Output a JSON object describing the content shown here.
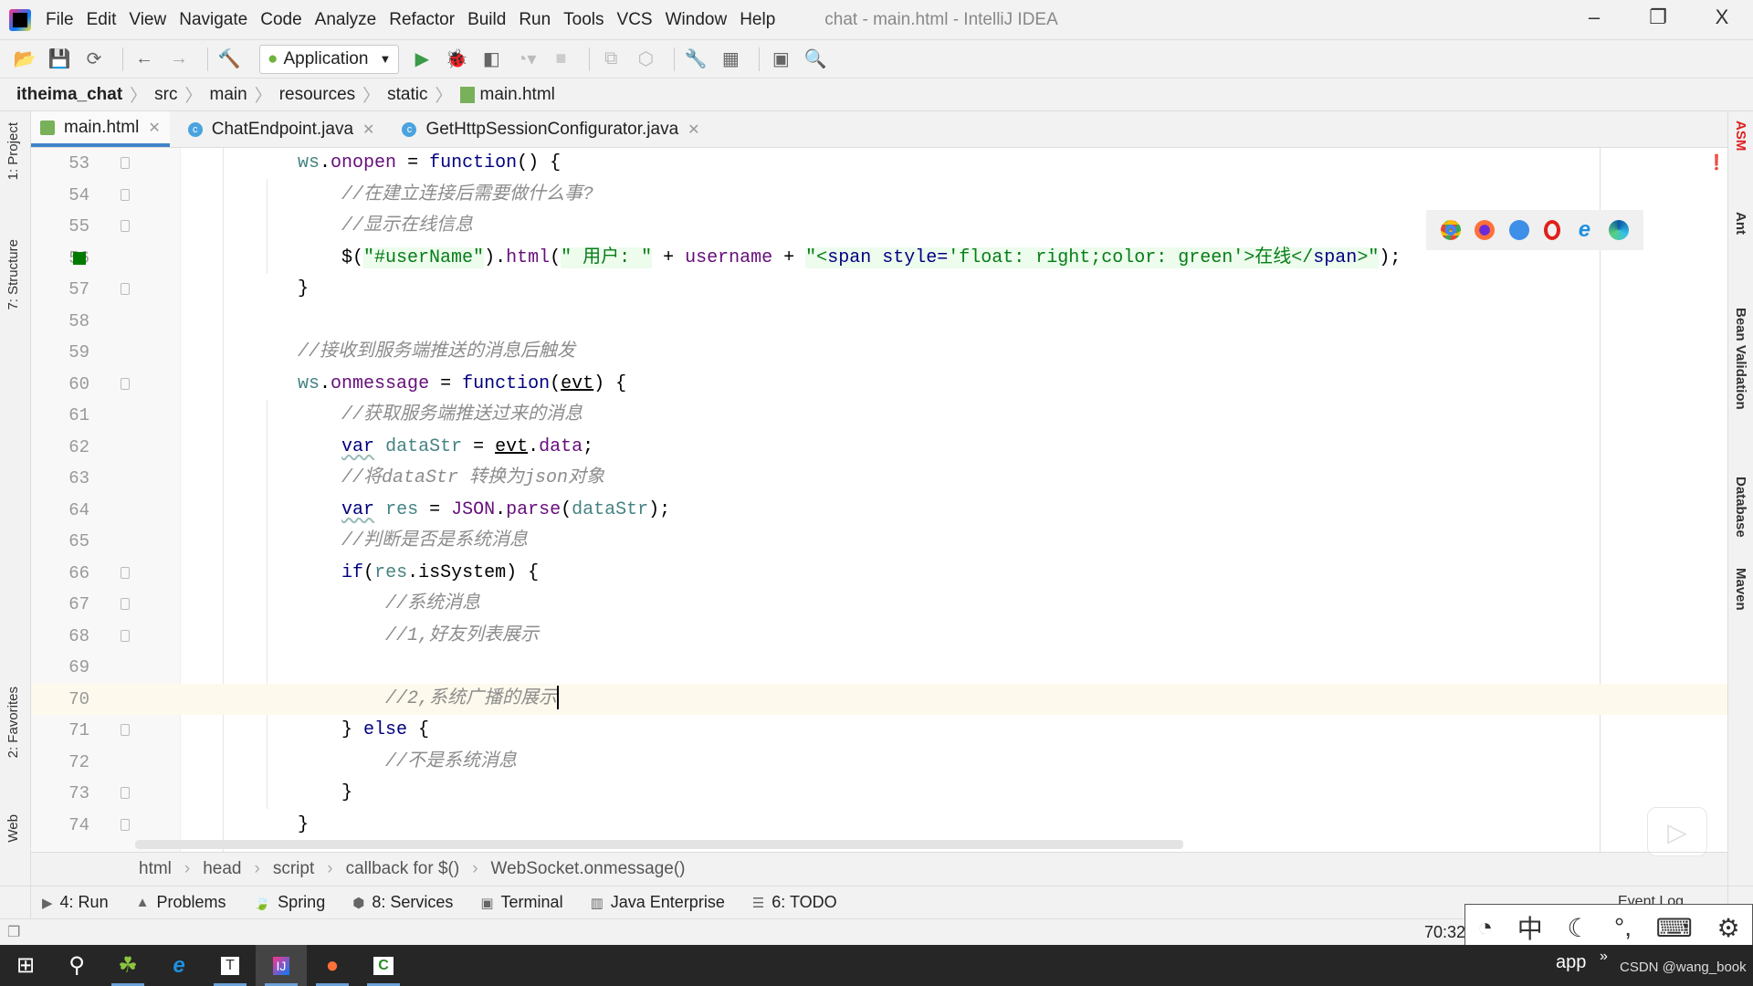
{
  "window": {
    "title": "chat - main.html - IntelliJ IDEA",
    "minimize": "–",
    "restore": "❐",
    "close": "X"
  },
  "menu": [
    "File",
    "Edit",
    "View",
    "Navigate",
    "Code",
    "Analyze",
    "Refactor",
    "Build",
    "Run",
    "Tools",
    "VCS",
    "Window",
    "Help"
  ],
  "toolbar": {
    "run_config": "Application"
  },
  "breadcrumb": [
    "itheima_chat",
    "src",
    "main",
    "resources",
    "static",
    "main.html"
  ],
  "tabs": [
    {
      "label": "main.html",
      "active": true,
      "icon": "html-file-icon"
    },
    {
      "label": "ChatEndpoint.java",
      "icon": "java-class-icon"
    },
    {
      "label": "GetHttpSessionConfigurator.java",
      "icon": "java-class-icon"
    }
  ],
  "left_tools": [
    "1: Project",
    "7: Structure",
    "2: Favorites",
    "Web"
  ],
  "right_tools": [
    "ASM",
    "Ant",
    "Bean Validation",
    "Database",
    "Maven"
  ],
  "code": {
    "current_line": 70,
    "lines": [
      {
        "n": 53,
        "fold": true,
        "tokens": [
          [
            "t",
            "        "
          ],
          [
            "v",
            "ws"
          ],
          [
            "t",
            "."
          ],
          [
            "p",
            "onopen"
          ],
          [
            "t",
            " = "
          ],
          [
            "k",
            "function"
          ],
          [
            "t",
            "() {"
          ]
        ]
      },
      {
        "n": 54,
        "fold": true,
        "tokens": [
          [
            "t",
            "            "
          ],
          [
            "c",
            "//在建立连接后需要做什么事?"
          ]
        ]
      },
      {
        "n": 55,
        "fold": true,
        "tokens": [
          [
            "t",
            "            "
          ],
          [
            "c",
            "//显示在线信息"
          ]
        ]
      },
      {
        "n": 56,
        "mark": true,
        "tokens": [
          [
            "t",
            "            $("
          ],
          [
            "s",
            "\"#userName\""
          ],
          [
            "t",
            ")."
          ],
          [
            "p",
            "html"
          ],
          [
            "t",
            "("
          ],
          [
            "s",
            "\" 用户: \""
          ],
          [
            "t",
            " + "
          ],
          [
            "p",
            "username"
          ],
          [
            "t",
            " + "
          ],
          [
            "s",
            "\"<"
          ],
          [
            "g",
            "span style="
          ],
          [
            "s",
            "'float: right;color: green'"
          ],
          [
            "s",
            ">在线</"
          ],
          [
            "g",
            "span"
          ],
          [
            "s",
            ">\""
          ],
          [
            "t",
            ");"
          ]
        ]
      },
      {
        "n": 57,
        "fold": true,
        "tokens": [
          [
            "t",
            "        }"
          ]
        ]
      },
      {
        "n": 58,
        "tokens": []
      },
      {
        "n": 59,
        "tokens": [
          [
            "t",
            "        "
          ],
          [
            "c",
            "//接收到服务端推送的消息后触发"
          ]
        ]
      },
      {
        "n": 60,
        "fold": true,
        "tokens": [
          [
            "t",
            "        "
          ],
          [
            "v",
            "ws"
          ],
          [
            "t",
            "."
          ],
          [
            "p",
            "onmessage"
          ],
          [
            "t",
            " = "
          ],
          [
            "k",
            "function"
          ],
          [
            "t",
            "("
          ],
          [
            "u",
            "evt"
          ],
          [
            "t",
            ") {"
          ]
        ]
      },
      {
        "n": 61,
        "tokens": [
          [
            "t",
            "            "
          ],
          [
            "c",
            "//获取服务端推送过来的消息"
          ]
        ]
      },
      {
        "n": 62,
        "tokens": [
          [
            "t",
            "            "
          ],
          [
            "w",
            "var"
          ],
          [
            "t",
            " "
          ],
          [
            "v",
            "dataStr"
          ],
          [
            "t",
            " = "
          ],
          [
            "u",
            "evt"
          ],
          [
            "t",
            "."
          ],
          [
            "p",
            "data"
          ],
          [
            "t",
            ";"
          ]
        ]
      },
      {
        "n": 63,
        "tokens": [
          [
            "t",
            "            "
          ],
          [
            "c",
            "//将dataStr 转换为json对象"
          ]
        ]
      },
      {
        "n": 64,
        "tokens": [
          [
            "t",
            "            "
          ],
          [
            "w",
            "var"
          ],
          [
            "t",
            " "
          ],
          [
            "v",
            "res"
          ],
          [
            "t",
            " = "
          ],
          [
            "p",
            "JSON"
          ],
          [
            "t",
            "."
          ],
          [
            "p",
            "parse"
          ],
          [
            "t",
            "("
          ],
          [
            "v",
            "dataStr"
          ],
          [
            "t",
            ");"
          ]
        ]
      },
      {
        "n": 65,
        "tokens": [
          [
            "t",
            "            "
          ],
          [
            "c",
            "//判断是否是系统消息"
          ]
        ]
      },
      {
        "n": 66,
        "fold": true,
        "tokens": [
          [
            "t",
            "            "
          ],
          [
            "k",
            "if"
          ],
          [
            "t",
            "("
          ],
          [
            "v",
            "res"
          ],
          [
            "t",
            "."
          ],
          [
            "t",
            "isSystem"
          ],
          [
            "t",
            ") {"
          ]
        ]
      },
      {
        "n": 67,
        "fold": true,
        "tokens": [
          [
            "t",
            "                "
          ],
          [
            "c",
            "//系统消息"
          ]
        ]
      },
      {
        "n": 68,
        "fold": true,
        "tokens": [
          [
            "t",
            "                "
          ],
          [
            "c",
            "//1,好友列表展示"
          ]
        ]
      },
      {
        "n": 69,
        "tokens": []
      },
      {
        "n": 70,
        "caret": true,
        "tokens": [
          [
            "t",
            "                "
          ],
          [
            "c",
            "//2,系统广播的展示"
          ]
        ]
      },
      {
        "n": 71,
        "fold": true,
        "tokens": [
          [
            "t",
            "            } "
          ],
          [
            "k",
            "else"
          ],
          [
            "t",
            " {"
          ]
        ]
      },
      {
        "n": 72,
        "tokens": [
          [
            "t",
            "                "
          ],
          [
            "c",
            "//不是系统消息"
          ]
        ]
      },
      {
        "n": 73,
        "fold": true,
        "tokens": [
          [
            "t",
            "            }"
          ]
        ]
      },
      {
        "n": 74,
        "fold": true,
        "tokens": [
          [
            "t",
            "        }"
          ]
        ]
      }
    ]
  },
  "editor_breadcrumb": [
    "html",
    "head",
    "script",
    "callback for $()",
    "WebSocket.onmessage()"
  ],
  "tool_windows": [
    {
      "label": "4: Run",
      "icon": "run-icon"
    },
    {
      "label": "Problems",
      "icon": "warning-icon"
    },
    {
      "label": "Spring",
      "icon": "spring-icon"
    },
    {
      "label": "8: Services",
      "icon": "services-icon"
    },
    {
      "label": "Terminal",
      "icon": "terminal-icon"
    },
    {
      "label": "Java Enterprise",
      "icon": "java-enterprise-icon"
    },
    {
      "label": "6: TODO",
      "icon": "todo-icon"
    }
  ],
  "event_log": "Event Log",
  "status": {
    "position": "70:32"
  },
  "ime": {
    "lang": "中"
  },
  "taskbar": {
    "tray_text": "app",
    "watermark": "CSDN @wang_book"
  },
  "colors": {
    "accent": "#4083c9",
    "current_line": "#fdf9ec",
    "string": "#067d17",
    "keyword": "#000080",
    "comment": "#8c8c8c"
  }
}
